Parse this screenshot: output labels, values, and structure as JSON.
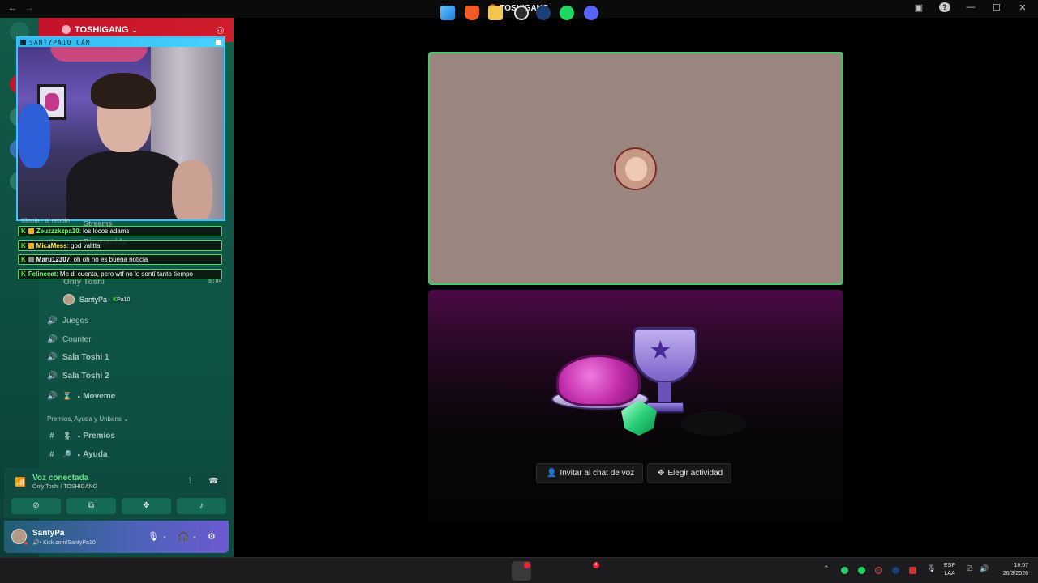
{
  "window": {
    "title": "TOSHIGANG"
  },
  "server": {
    "name": "TOSHIGANG"
  },
  "cam": {
    "label": "SANTYPA10 CAM"
  },
  "chat": [
    {
      "user": "Zeuzzzkzpa10",
      "text": ": los locos adams",
      "color": "g"
    },
    {
      "user": "MicaMess",
      "text": ": god valitta",
      "color": "y"
    },
    {
      "user": "Maru12307",
      "text": ": oh oh no es buena noticia",
      "color": "w"
    },
    {
      "user": "Felinecat",
      "text": ": Me di cuenta, pero wtf no lo sentí tanto tiempo",
      "color": "g"
    }
  ],
  "chat_faded": "tillopia : al reppin",
  "ghost": {
    "streams": "Streams",
    "bienvenida": "Bienvenida",
    "only_toshi": "Only Toshi",
    "time": "0:04"
  },
  "voice_user": {
    "name": "SantyPa",
    "tag_k": "K",
    "tag": "Pa10"
  },
  "channels": [
    {
      "name": "Juegos"
    },
    {
      "name": "Counter"
    },
    {
      "name": "Sala Toshi 1"
    },
    {
      "name": "Sala Toshi 2"
    },
    {
      "name": "Moveme",
      "emoji": "⌛",
      "sep": "・"
    }
  ],
  "category": "Premios, Ayuda y Unbans",
  "text_channels": [
    {
      "name": "Premios",
      "emoji": "🎖",
      "sep": "・"
    },
    {
      "name": "Ayuda",
      "emoji": "🔎",
      "sep": "・"
    }
  ],
  "voice_panel": {
    "status": "Voz conectada",
    "location": "Only Toshi / TOSHIGANG"
  },
  "user_panel": {
    "name": "SantyPa",
    "subtitle": "Kick.com/SantyPa10"
  },
  "stage": {
    "invite_label": "Invitar al chat de voz",
    "activity_label": "Elegir actividad"
  },
  "taskbar": {
    "lang1": "ESP",
    "lang2": "LAA",
    "time": "16:57",
    "date": "26/3/2026",
    "discord_badge": "4"
  },
  "colors": {
    "speaking": "#3ecf6a",
    "accent": "#5865f2",
    "kick": "#53fc18"
  }
}
